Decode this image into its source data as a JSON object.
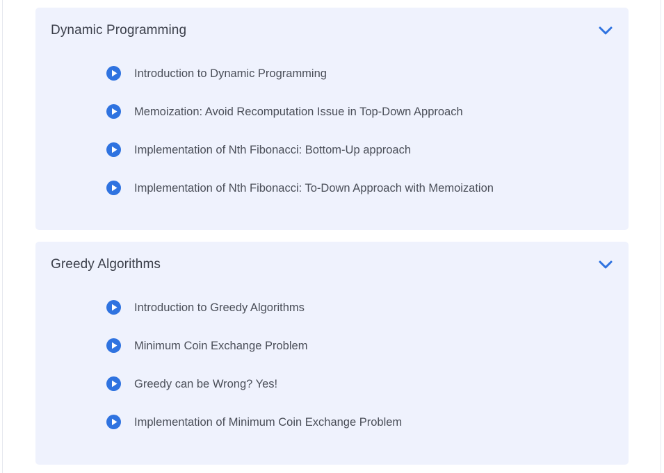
{
  "theme": {
    "accent": "#2f73e0",
    "panel_bg": "#eff2fd",
    "text": "#4a4e58"
  },
  "sections": [
    {
      "title": "Dynamic Programming",
      "toggle_icon": "chevron-down-icon",
      "lessons": [
        {
          "icon": "play-circle-icon",
          "label": "Introduction to Dynamic Programming"
        },
        {
          "icon": "play-circle-icon",
          "label": "Memoization: Avoid Recomputation Issue in Top-Down Approach"
        },
        {
          "icon": "play-circle-icon",
          "label": "Implementation of Nth Fibonacci: Bottom-Up approach"
        },
        {
          "icon": "play-circle-icon",
          "label": "Implementation of Nth Fibonacci: To-Down Approach with Memoization"
        }
      ]
    },
    {
      "title": "Greedy Algorithms",
      "toggle_icon": "chevron-down-icon",
      "lessons": [
        {
          "icon": "play-circle-icon",
          "label": "Introduction to Greedy Algorithms"
        },
        {
          "icon": "play-circle-icon",
          "label": "Minimum Coin Exchange Problem"
        },
        {
          "icon": "play-circle-icon",
          "label": "Greedy can be Wrong? Yes!"
        },
        {
          "icon": "play-circle-icon",
          "label": "Implementation of Minimum Coin Exchange Problem"
        }
      ]
    }
  ]
}
